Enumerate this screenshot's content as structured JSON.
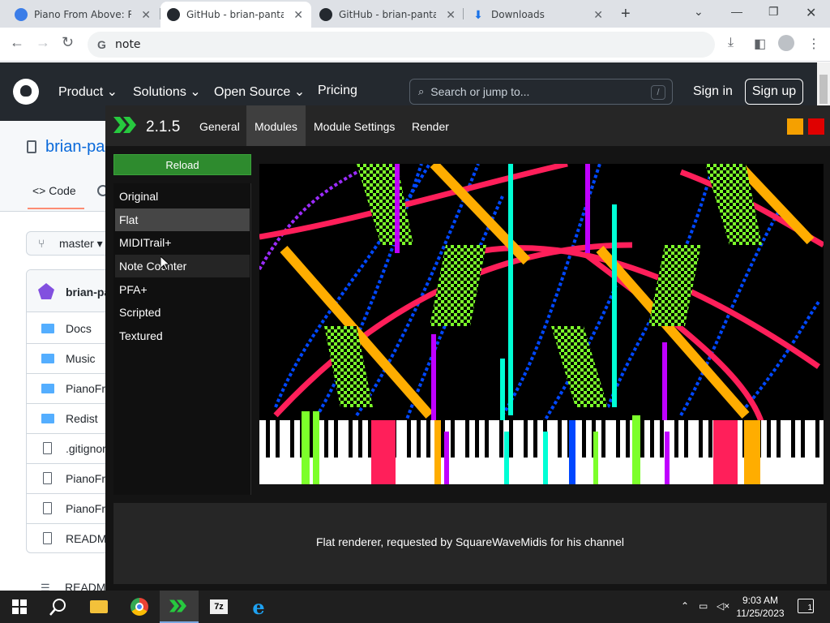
{
  "browser": {
    "tabs": [
      {
        "title": "Piano From Above: Re",
        "favicon_color": "#3b7de8",
        "active": false
      },
      {
        "title": "GitHub - brian-pantan",
        "favicon_color": "#24292f",
        "active": true
      },
      {
        "title": "GitHub - brian-pantan",
        "favicon_color": "#24292f",
        "active": false
      },
      {
        "title": "Downloads",
        "favicon_color": "#1a73e8",
        "active": false
      }
    ],
    "omnibox_value": "note"
  },
  "github": {
    "nav": [
      "Product",
      "Solutions",
      "Open Source",
      "Pricing"
    ],
    "search_placeholder": "Search or jump to...",
    "search_key": "/",
    "sign_in": "Sign in",
    "sign_up": "Sign up",
    "repo_title": "brian-pa",
    "code_tab": "Code",
    "branch": "master",
    "commit_author": "brian-pa",
    "files": [
      {
        "name": "Docs",
        "type": "folder"
      },
      {
        "name": "Music",
        "type": "folder"
      },
      {
        "name": "PianoFro",
        "type": "folder"
      },
      {
        "name": "Redist",
        "type": "folder"
      },
      {
        "name": ".gitignor",
        "type": "file"
      },
      {
        "name": "PianoFro",
        "type": "file"
      },
      {
        "name": "PianoFro",
        "type": "file"
      },
      {
        "name": "READMI",
        "type": "file"
      }
    ],
    "readme_heading": "READM"
  },
  "app": {
    "version": "2.1.5",
    "menu": [
      "General",
      "Modules",
      "Module Settings",
      "Render"
    ],
    "active_menu": "Modules",
    "reload_label": "Reload",
    "modules": [
      "Original",
      "Flat",
      "MIDITrail+",
      "Note Counter",
      "PFA+",
      "Scripted",
      "Textured"
    ],
    "selected_module": "Flat",
    "hovered_module": "Note Counter",
    "description": "Flat renderer, requested by SquareWaveMidis for his channel",
    "accent_colors": {
      "orange": "#f5a000",
      "red": "#e00000",
      "green": "#2e8b2e"
    }
  },
  "taskbar": {
    "time": "9:03 AM",
    "date": "11/25/2023",
    "notifications": "1"
  }
}
